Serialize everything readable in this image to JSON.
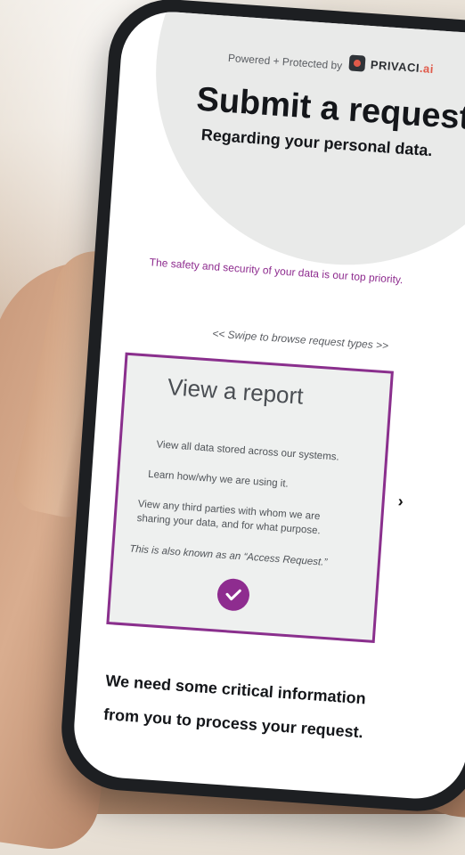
{
  "header": {
    "powered_label": "Powered + Protected by",
    "brand_name": "PRIVACI",
    "brand_suffix": ".ai",
    "title": "Submit a request",
    "subtitle": "Regarding your personal data."
  },
  "tagline": "The safety and security of your data is our top priority.",
  "swipe_hint": "<< Swipe to browse request types >>",
  "card": {
    "title": "View a report",
    "lines": [
      "View all data stored across our systems.",
      "Learn how/why we are using it.",
      "View any third parties with whom we are",
      "sharing your data, and for what purpose.",
      "This is also known as an “Access Request.”"
    ]
  },
  "next_arrow": "›",
  "footer": {
    "line1": "We need some critical information",
    "line2": "from you to process your request."
  },
  "colors": {
    "accent": "#8e2c8f",
    "brand_ai": "#e05a4a",
    "header_bg": "#e9eae9",
    "card_bg": "#eef0ef"
  }
}
